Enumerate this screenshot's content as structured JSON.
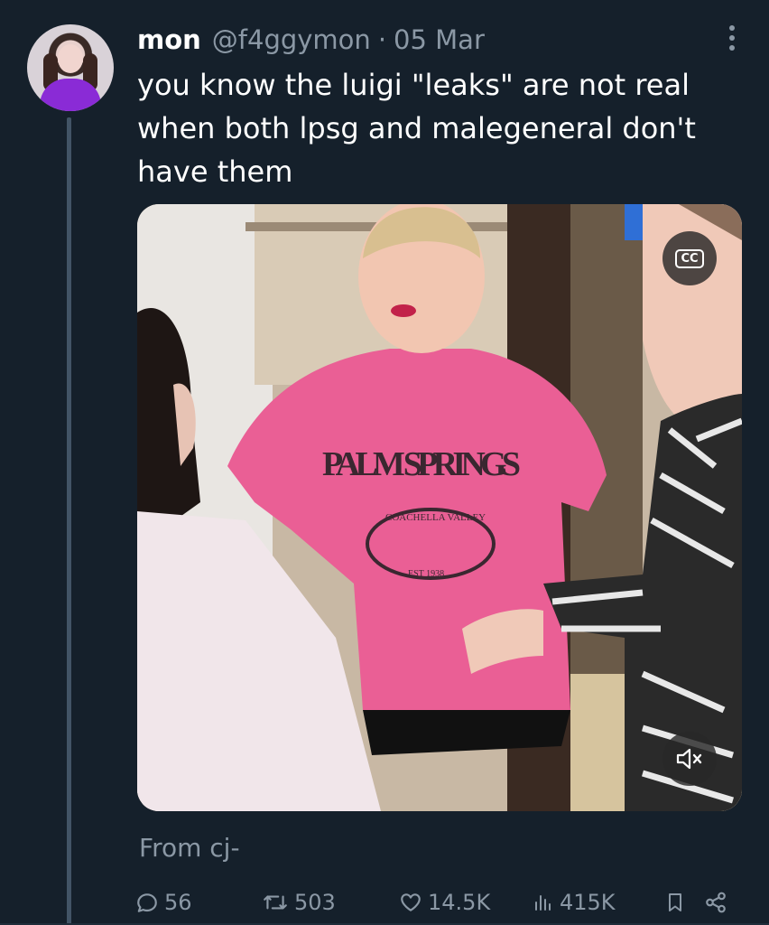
{
  "author": {
    "name": "mon",
    "handle": "@f4ggymon",
    "separator": "·",
    "date": "05 Mar"
  },
  "tweet": {
    "lines": [
      "you know the luigi \"leaks\" are not real",
      "when both lpsg and malegeneral don't",
      "have them"
    ]
  },
  "media": {
    "shirt_text": "PALM SPRINGS",
    "badge_text": "COACHELLA VALLEY",
    "est_text": "EST 1938",
    "cc_label": "CC"
  },
  "attribution": "From cj-",
  "actions": {
    "replies": "56",
    "retweets": "503",
    "likes": "14.5K",
    "views": "415K"
  },
  "colors": {
    "background": "#15202b",
    "secondary_text": "#8b98a5",
    "thread_line": "#425466"
  }
}
